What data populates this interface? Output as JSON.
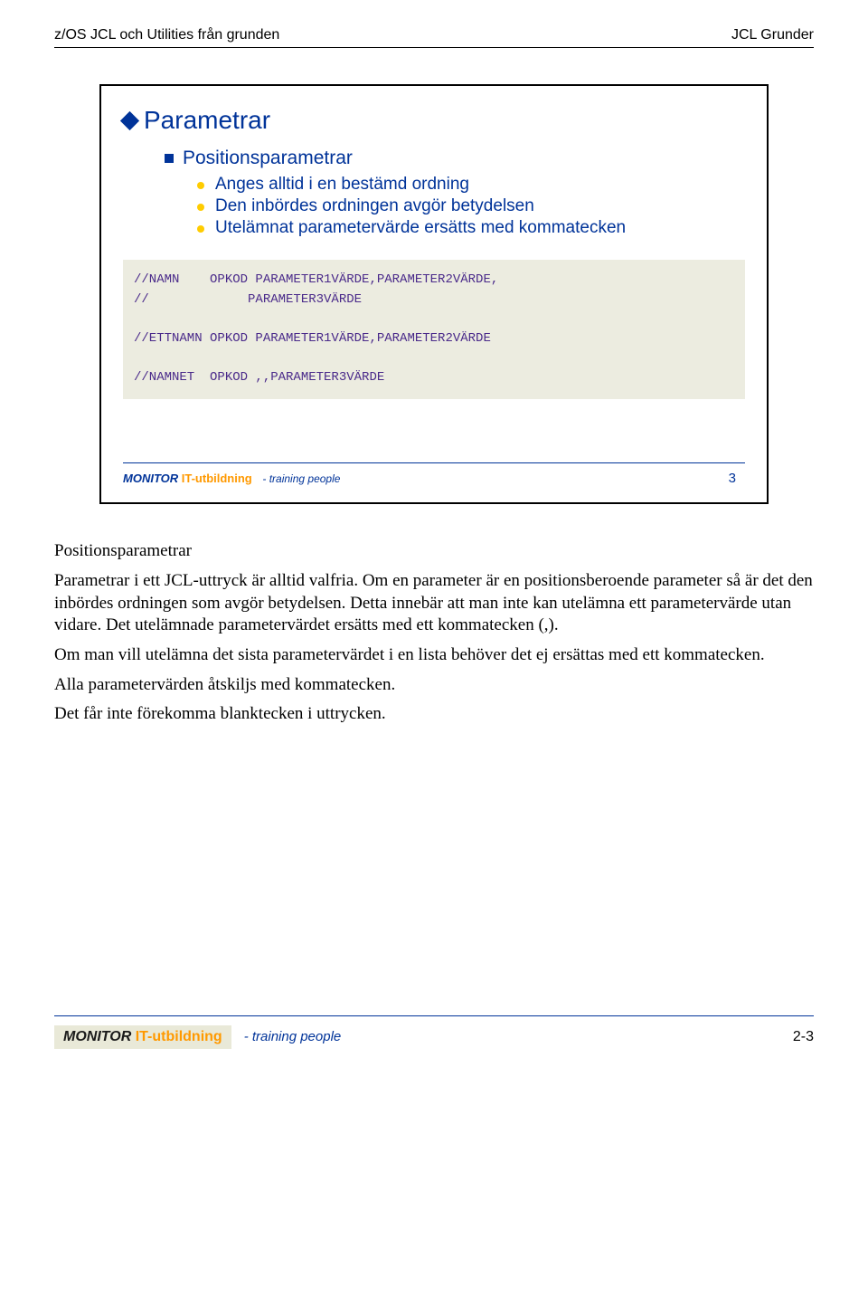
{
  "header": {
    "left": "z/OS JCL och Utilities från grunden",
    "right": "JCL Grunder"
  },
  "slide": {
    "title": "Parametrar",
    "sub": "Positionsparametrar",
    "bullets": [
      "Anges alltid i en bestämd ordning",
      "Den inbördes ordningen avgör betydelsen",
      "Utelämnat parametervärde ersätts med kommatecken"
    ],
    "code": "//NAMN    OPKOD PARAMETER1VÄRDE,PARAMETER2VÄRDE,\n//             PARAMETER3VÄRDE\n\n//ETTNAMN OPKOD PARAMETER1VÄRDE,PARAMETER2VÄRDE\n\n//NAMNET  OPKOD ,,PARAMETER3VÄRDE",
    "brand1": "MONITOR",
    "brand2": " IT-utbildning",
    "tagline": "- training people",
    "pagenum": "3"
  },
  "body": {
    "heading": "Positionsparametrar",
    "p1": "Parametrar i ett JCL-uttryck är alltid valfria. Om en parameter är en positionsberoende parameter så är det den inbördes ordningen som avgör betydelsen. Detta innebär att man inte kan utelämna ett parametervärde utan vidare. Det utelämnade parametervärdet ersätts med ett kommatecken (,).",
    "p2": "Om man vill utelämna det sista parametervärdet i en lista behöver det ej ersättas med ett kommatecken.",
    "p3": "Alla parametervärden åtskiljs med kommatecken.",
    "p4": "Det får inte förekomma blanktecken i uttrycken."
  },
  "footer": {
    "brand1": "MONITOR",
    "brand2": " IT-utbildning",
    "tagline": "- training people",
    "pagenum": "2-3"
  }
}
